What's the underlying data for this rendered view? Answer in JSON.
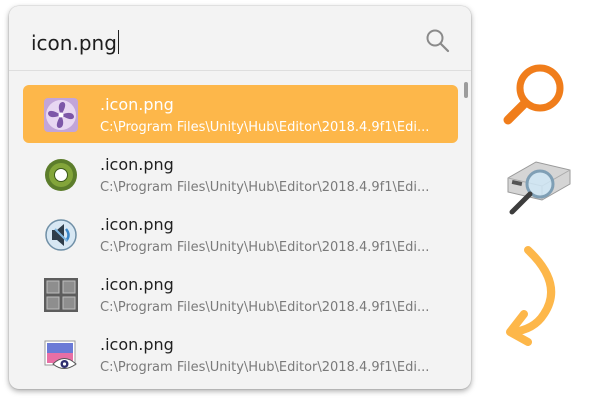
{
  "search": {
    "query": "icon.png"
  },
  "results": [
    {
      "name": ".icon.png",
      "path": "C:\\Program Files\\Unity\\Hub\\Editor\\2018.4.9f1\\Edi...",
      "icon": "fan-icon",
      "selected": true
    },
    {
      "name": ".icon.png",
      "path": "C:\\Program Files\\Unity\\Hub\\Editor\\2018.4.9f1\\Edi...",
      "icon": "green-ring-icon",
      "selected": false
    },
    {
      "name": ".icon.png",
      "path": "C:\\Program Files\\Unity\\Hub\\Editor\\2018.4.9f1\\Edi...",
      "icon": "speaker-icon",
      "selected": false
    },
    {
      "name": ".icon.png",
      "path": "C:\\Program Files\\Unity\\Hub\\Editor\\2018.4.9f1\\Edi...",
      "icon": "grid-icon",
      "selected": false
    },
    {
      "name": ".icon.png",
      "path": "C:\\Program Files\\Unity\\Hub\\Editor\\2018.4.9f1\\Edi...",
      "icon": "image-eye-icon",
      "selected": false
    }
  ],
  "colors": {
    "accent": "#fdb74a",
    "magnifier_orange": "#f07d1b"
  },
  "decorations": [
    "magnifier-icon",
    "drive-search-icon",
    "curved-arrow-icon"
  ]
}
